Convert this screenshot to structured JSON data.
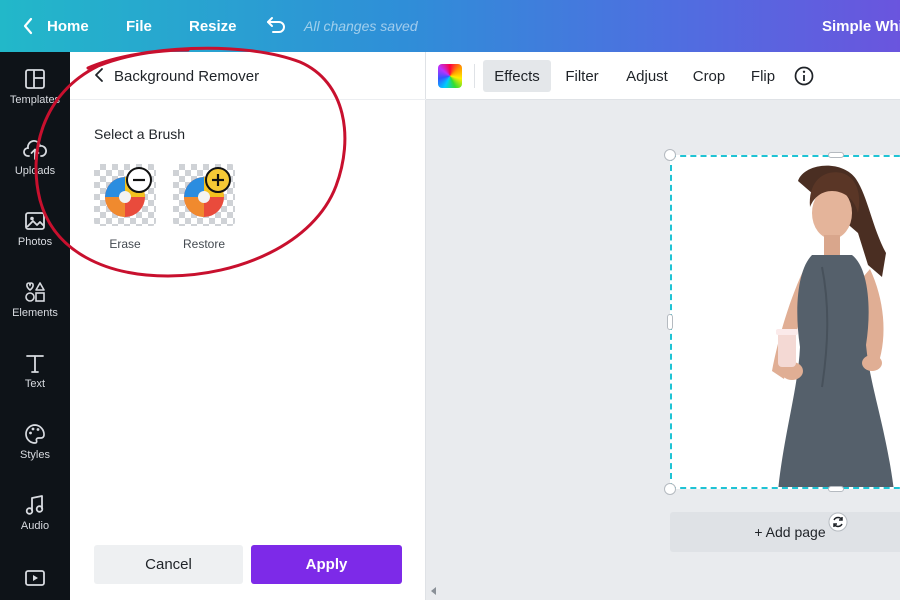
{
  "topbar": {
    "home": "Home",
    "file": "File",
    "resize": "Resize",
    "status": "All changes saved",
    "doc_title": "Simple Whit"
  },
  "rail": {
    "items": [
      {
        "label": "Templates",
        "icon": "templates-icon"
      },
      {
        "label": "Uploads",
        "icon": "upload-cloud-icon"
      },
      {
        "label": "Photos",
        "icon": "photo-icon"
      },
      {
        "label": "Elements",
        "icon": "shapes-icon"
      },
      {
        "label": "Text",
        "icon": "text-icon"
      },
      {
        "label": "Styles",
        "icon": "palette-icon"
      },
      {
        "label": "Audio",
        "icon": "music-note-icon"
      },
      {
        "label": "",
        "icon": "video-icon"
      }
    ]
  },
  "panel": {
    "title": "Background Remover",
    "select_brush": "Select a Brush",
    "brushes": [
      {
        "label": "Erase",
        "badge": "minus-icon"
      },
      {
        "label": "Restore",
        "badge": "plus-icon"
      }
    ],
    "cancel": "Cancel",
    "apply": "Apply"
  },
  "toolbar": {
    "items": [
      "Effects",
      "Filter",
      "Adjust",
      "Crop",
      "Flip"
    ],
    "active": "Effects"
  },
  "canvas": {
    "add_page": "+ Add page"
  },
  "colors": {
    "accent": "#7d2ae8",
    "selection": "#1fc3d4",
    "annotation": "#c8102e"
  }
}
